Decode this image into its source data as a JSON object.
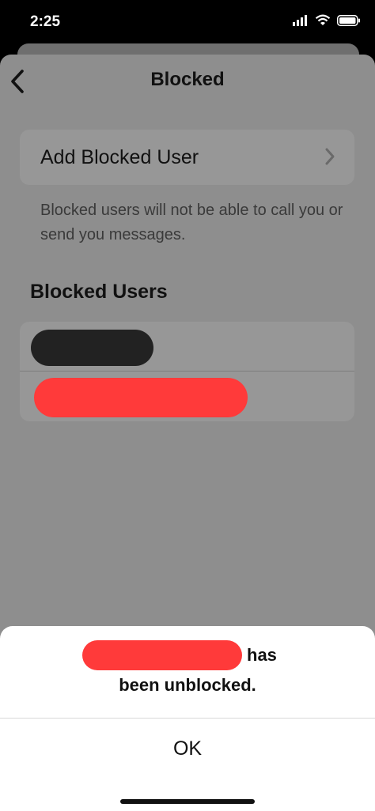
{
  "status_bar": {
    "time": "2:25"
  },
  "nav": {
    "title": "Blocked",
    "back_icon": "chevron-left-icon"
  },
  "add_row": {
    "label": "Add Blocked User",
    "chevron_icon": "chevron-right-icon"
  },
  "note": "Blocked users will not be able to call you or send you messages.",
  "blocked_section": {
    "header": "Blocked Users",
    "rows": 2
  },
  "alert": {
    "line1_suffix": "has",
    "line2": "been unblocked.",
    "ok_label": "OK"
  },
  "colors": {
    "dim_overlay": "#8e8e8e",
    "redaction_red": "#ff3a3a",
    "redaction_black": "#222222"
  }
}
